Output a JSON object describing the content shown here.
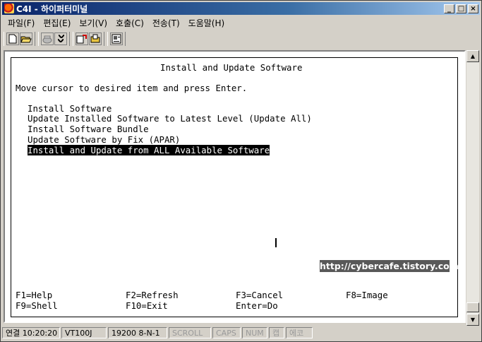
{
  "window": {
    "title": "C4I - 하이퍼터미널",
    "controls": {
      "minimize": "_",
      "maximize": "□",
      "close": "×"
    }
  },
  "menu": {
    "items": [
      "파일(F)",
      "편집(E)",
      "보기(V)",
      "호출(C)",
      "전송(T)",
      "도움말(H)"
    ]
  },
  "toolbar": {
    "buttons": [
      "new-icon",
      "open-icon",
      "phone-icon",
      "disconnect-icon",
      "send-icon",
      "receive-icon",
      "properties-icon"
    ]
  },
  "terminal": {
    "header": "Install and Update Software",
    "prompt": "Move cursor to desired item and press Enter.",
    "options": [
      "Install Software",
      "Update Installed Software to Latest Level (Update All)",
      "Install Software Bundle",
      "Update Software by Fix (APAR)",
      "Install and Update from ALL Available Software"
    ],
    "selected_index": 4,
    "function_keys": {
      "f1": "F1=Help",
      "f2": "F2=Refresh",
      "f3": "F3=Cancel",
      "f8": "F8=Image",
      "f9": "F9=Shell",
      "f10": "F10=Exit",
      "enter": "Enter=Do"
    },
    "watermark": "http://cybercafe.tistory.com"
  },
  "statusbar": {
    "connected": "연결 10:20:20",
    "emulation": "VT100J",
    "port": "19200 8-N-1",
    "scroll": "SCROLL",
    "caps": "CAPS",
    "num": "NUM",
    "capture": "캡",
    "echo": "에코"
  },
  "colors": {
    "title_start": "#0a246a",
    "title_end": "#a6caf0",
    "chrome": "#d4d0c8",
    "highlight_bg": "#000000",
    "highlight_fg": "#ffffff",
    "watermark_bg": "#595959"
  }
}
